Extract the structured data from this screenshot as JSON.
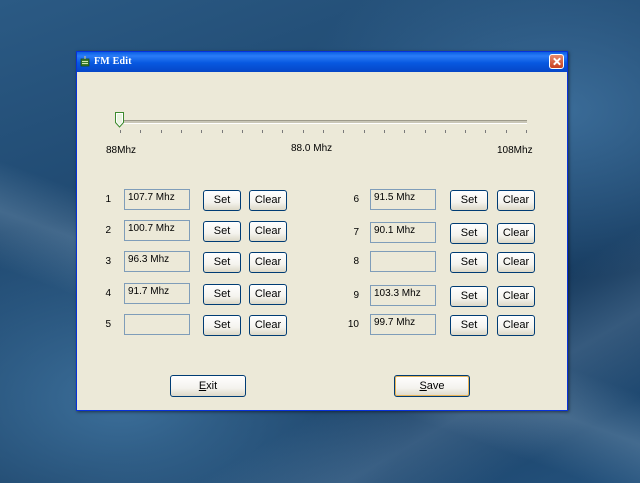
{
  "window": {
    "title": "FM Edit"
  },
  "slider": {
    "min_label": "88Mhz",
    "current_label": "88.0 Mhz",
    "max_label": "108Mhz",
    "value_fraction": 0.0
  },
  "presets_left": [
    {
      "num": "1",
      "value": "107.7 Mhz"
    },
    {
      "num": "2",
      "value": "100.7 Mhz"
    },
    {
      "num": "3",
      "value": "96.3 Mhz"
    },
    {
      "num": "4",
      "value": "91.7 Mhz"
    },
    {
      "num": "5",
      "value": ""
    }
  ],
  "presets_right": [
    {
      "num": "6",
      "value": "91.5 Mhz"
    },
    {
      "num": "7",
      "value": "90.1 Mhz"
    },
    {
      "num": "8",
      "value": ""
    },
    {
      "num": "9",
      "value": "103.3 Mhz"
    },
    {
      "num": "10",
      "value": "99.7 Mhz"
    }
  ],
  "buttons": {
    "set_label": "Set",
    "clear_label": "Clear",
    "exit_hotkey": "E",
    "exit_rest": "xit",
    "save_hotkey": "S",
    "save_rest": "ave"
  },
  "colors": {
    "titlebar": "#0758e0",
    "window_bg": "#ece9d8",
    "close_button": "#c8401f"
  }
}
